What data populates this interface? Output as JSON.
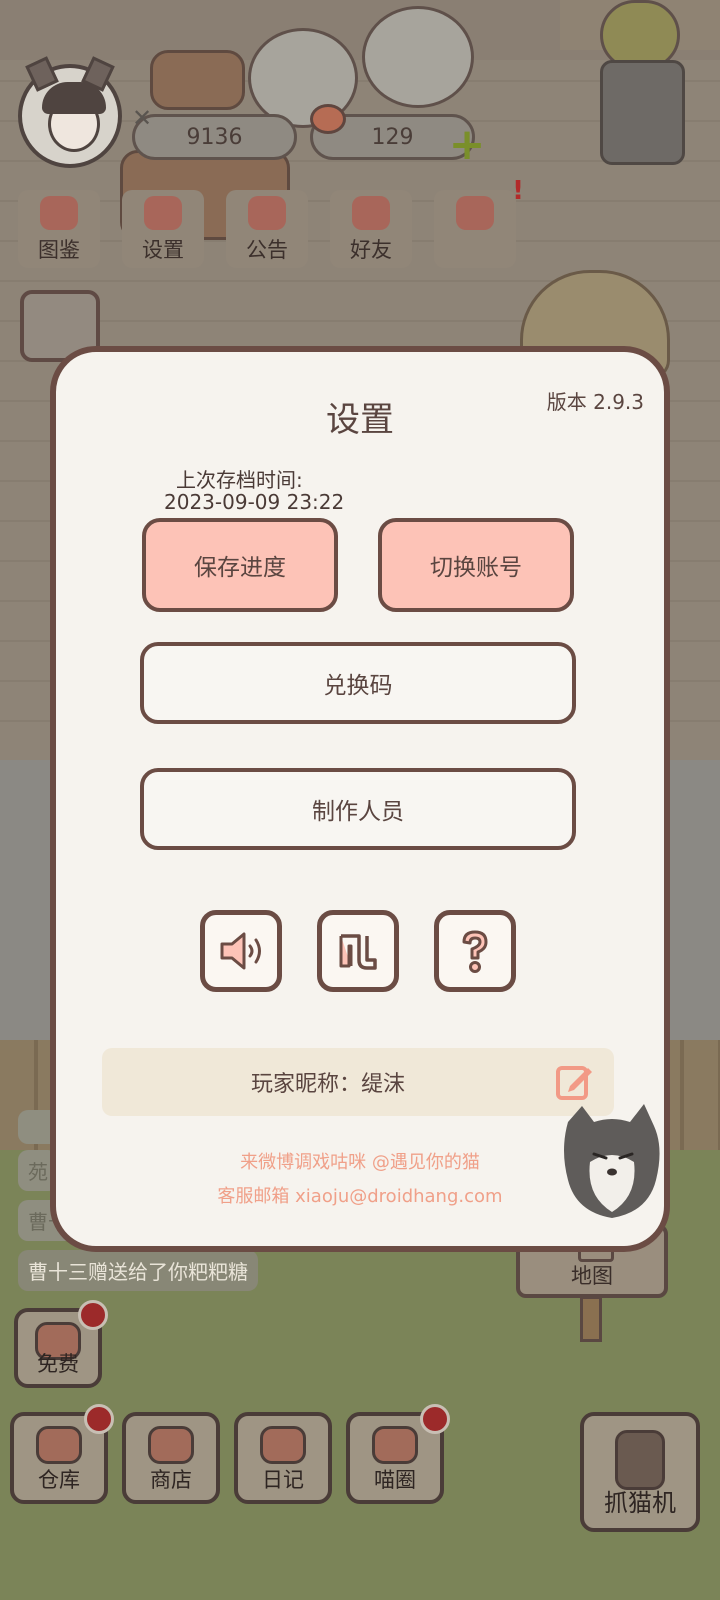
{
  "hud": {
    "fish_count": "9136",
    "apple_count": "129",
    "top_nav": [
      "图鉴",
      "设置",
      "公告",
      "好友"
    ]
  },
  "dialog": {
    "title": "设置",
    "version": "版本 2.9.3",
    "last_save_label": "上次存档时间:",
    "last_save_time": "2023-09-09 23:22",
    "save_button": "保存进度",
    "switch_account_button": "切换账号",
    "redeem_button": "兑换码",
    "credits_button": "制作人员",
    "icons": [
      "sound-icon",
      "music-icon",
      "help-icon"
    ],
    "nickname": "玩家昵称：缇沫",
    "footer_weibo": "来微博调戏咕咪 @遇见你的猫",
    "footer_email": "客服邮箱 xiaoju@droidhang.com"
  },
  "chat": {
    "line2": "苑",
    "line3": "曹十",
    "line4": "曹十三赠送给了你粑粑糖"
  },
  "bottom": {
    "free": "免费",
    "storage": "仓库",
    "shop": "商店",
    "diary": "日记",
    "circle": "喵圈",
    "claw": "抓猫机",
    "map": "地图"
  },
  "colors": {
    "accent_pink": "#fdc3b7",
    "border_brown": "#6b4c44",
    "footer_text": "#f0a089",
    "badge_red": "#9c2a2a"
  }
}
